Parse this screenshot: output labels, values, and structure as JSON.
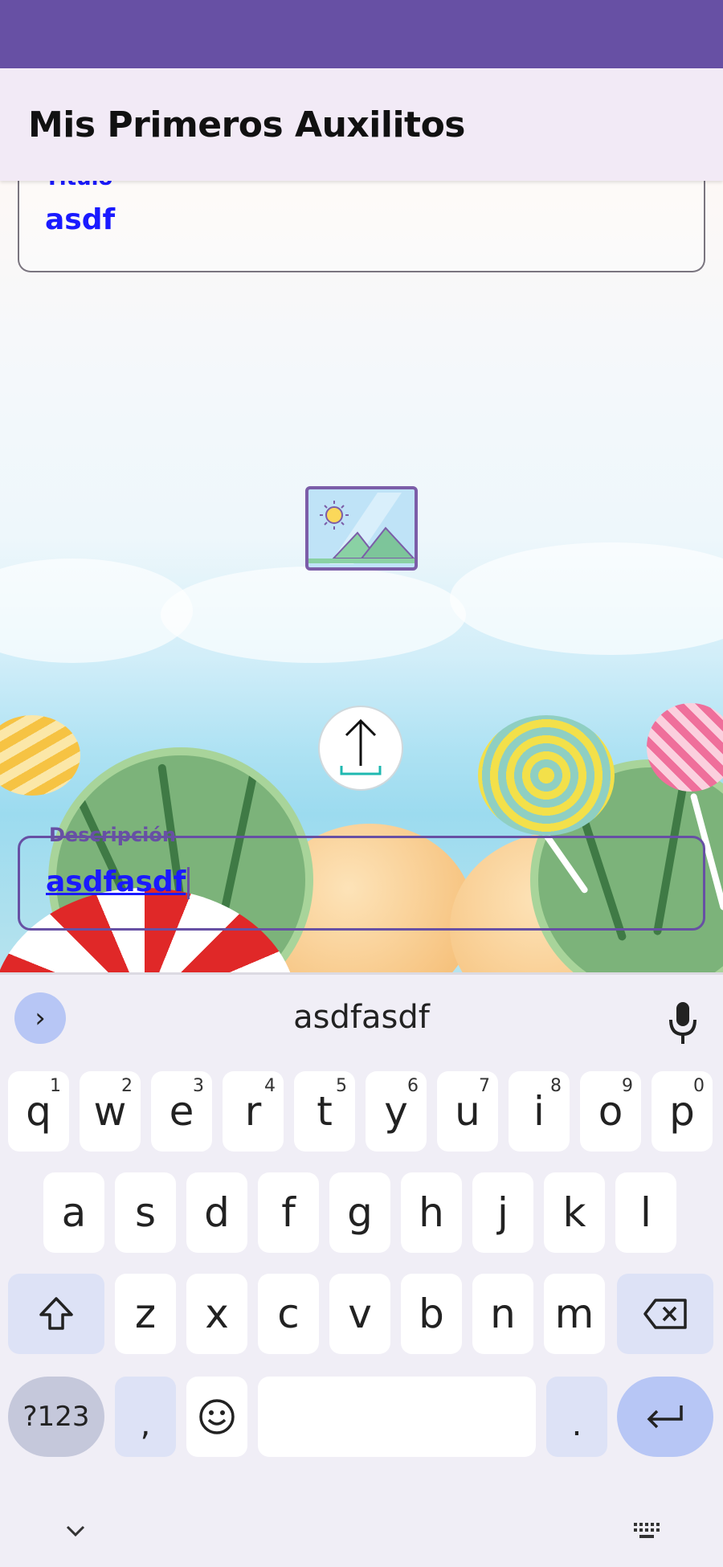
{
  "app": {
    "title": "Mis Primeros Auxilitos"
  },
  "form": {
    "title_label": "Título",
    "title_value": "asdf",
    "description_label": "Descripción",
    "description_value": "asdfasdf"
  },
  "keyboard": {
    "suggestion": "asdfasdf",
    "row1": [
      {
        "k": "q",
        "h": "1"
      },
      {
        "k": "w",
        "h": "2"
      },
      {
        "k": "e",
        "h": "3"
      },
      {
        "k": "r",
        "h": "4"
      },
      {
        "k": "t",
        "h": "5"
      },
      {
        "k": "y",
        "h": "6"
      },
      {
        "k": "u",
        "h": "7"
      },
      {
        "k": "i",
        "h": "8"
      },
      {
        "k": "o",
        "h": "9"
      },
      {
        "k": "p",
        "h": "0"
      }
    ],
    "row2": [
      "a",
      "s",
      "d",
      "f",
      "g",
      "h",
      "j",
      "k",
      "l"
    ],
    "row3": [
      "z",
      "x",
      "c",
      "v",
      "b",
      "n",
      "m"
    ],
    "symbols_label": "?123",
    "comma": ",",
    "period": "."
  },
  "colors": {
    "primary": "#6750a4",
    "field_text": "#1a1aff",
    "keyboard_bg": "#f0eef6"
  }
}
